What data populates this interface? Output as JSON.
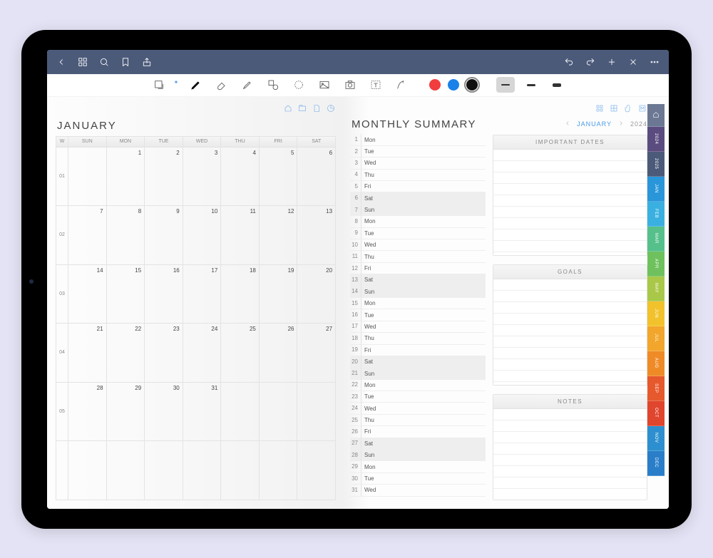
{
  "titlebar": {},
  "toolbar": {
    "colors": [
      "#f13d3d",
      "#1a81e8",
      "#111111"
    ]
  },
  "left_page": {
    "title": "JANUARY",
    "week_header": "W",
    "day_headers": [
      "SUN",
      "MON",
      "TUE",
      "WED",
      "THU",
      "FRI",
      "SAT"
    ],
    "weeks": [
      {
        "wk": "01",
        "cells": [
          "",
          "1",
          "2",
          "3",
          "4",
          "5",
          "6"
        ]
      },
      {
        "wk": "02",
        "cells": [
          "7",
          "8",
          "9",
          "10",
          "11",
          "12",
          "13"
        ]
      },
      {
        "wk": "03",
        "cells": [
          "14",
          "15",
          "16",
          "17",
          "18",
          "19",
          "20"
        ]
      },
      {
        "wk": "04",
        "cells": [
          "21",
          "22",
          "23",
          "24",
          "25",
          "26",
          "27"
        ]
      },
      {
        "wk": "05",
        "cells": [
          "28",
          "29",
          "30",
          "31",
          "",
          "",
          ""
        ]
      },
      {
        "wk": "",
        "cells": [
          "",
          "",
          "",
          "",
          "",
          "",
          ""
        ]
      }
    ]
  },
  "right_page": {
    "title": "MONTHLY SUMMARY",
    "nav_month": "JANUARY",
    "nav_year": "2024",
    "days": [
      {
        "n": "1",
        "w": "Mon",
        "wk": false
      },
      {
        "n": "2",
        "w": "Tue",
        "wk": false
      },
      {
        "n": "3",
        "w": "Wed",
        "wk": false
      },
      {
        "n": "4",
        "w": "Thu",
        "wk": false
      },
      {
        "n": "5",
        "w": "Fri",
        "wk": false
      },
      {
        "n": "6",
        "w": "Sat",
        "wk": true
      },
      {
        "n": "7",
        "w": "Sun",
        "wk": true
      },
      {
        "n": "8",
        "w": "Mon",
        "wk": false
      },
      {
        "n": "9",
        "w": "Tue",
        "wk": false
      },
      {
        "n": "10",
        "w": "Wed",
        "wk": false
      },
      {
        "n": "11",
        "w": "Thu",
        "wk": false
      },
      {
        "n": "12",
        "w": "Fri",
        "wk": false
      },
      {
        "n": "13",
        "w": "Sat",
        "wk": true
      },
      {
        "n": "14",
        "w": "Sun",
        "wk": true
      },
      {
        "n": "15",
        "w": "Mon",
        "wk": false
      },
      {
        "n": "16",
        "w": "Tue",
        "wk": false
      },
      {
        "n": "17",
        "w": "Wed",
        "wk": false
      },
      {
        "n": "18",
        "w": "Thu",
        "wk": false
      },
      {
        "n": "19",
        "w": "Fri",
        "wk": false
      },
      {
        "n": "20",
        "w": "Sat",
        "wk": true
      },
      {
        "n": "21",
        "w": "Sun",
        "wk": true
      },
      {
        "n": "22",
        "w": "Mon",
        "wk": false
      },
      {
        "n": "23",
        "w": "Tue",
        "wk": false
      },
      {
        "n": "24",
        "w": "Wed",
        "wk": false
      },
      {
        "n": "25",
        "w": "Thu",
        "wk": false
      },
      {
        "n": "26",
        "w": "Fri",
        "wk": false
      },
      {
        "n": "27",
        "w": "Sat",
        "wk": true
      },
      {
        "n": "28",
        "w": "Sun",
        "wk": true
      },
      {
        "n": "29",
        "w": "Mon",
        "wk": false
      },
      {
        "n": "30",
        "w": "Tue",
        "wk": false
      },
      {
        "n": "31",
        "w": "Wed",
        "wk": false
      }
    ],
    "panel_important": "IMPORTANT DATES",
    "panel_goals": "GOALS",
    "panel_notes": "NOTES"
  },
  "side_tabs": [
    "2024",
    "2025",
    "JAN",
    "FEB",
    "MAR",
    "APR",
    "MAY",
    "JUN",
    "JUL",
    "AUG",
    "SEP",
    "OCT",
    "NOV",
    "DEC"
  ],
  "side_tab_classes": [
    "tab-2024",
    "tab-2025",
    "tab-jan",
    "tab-feb",
    "tab-mar",
    "tab-apr",
    "tab-may",
    "tab-jun",
    "tab-jul",
    "tab-aug",
    "tab-sep",
    "tab-oct",
    "tab-nov",
    "tab-dec"
  ]
}
